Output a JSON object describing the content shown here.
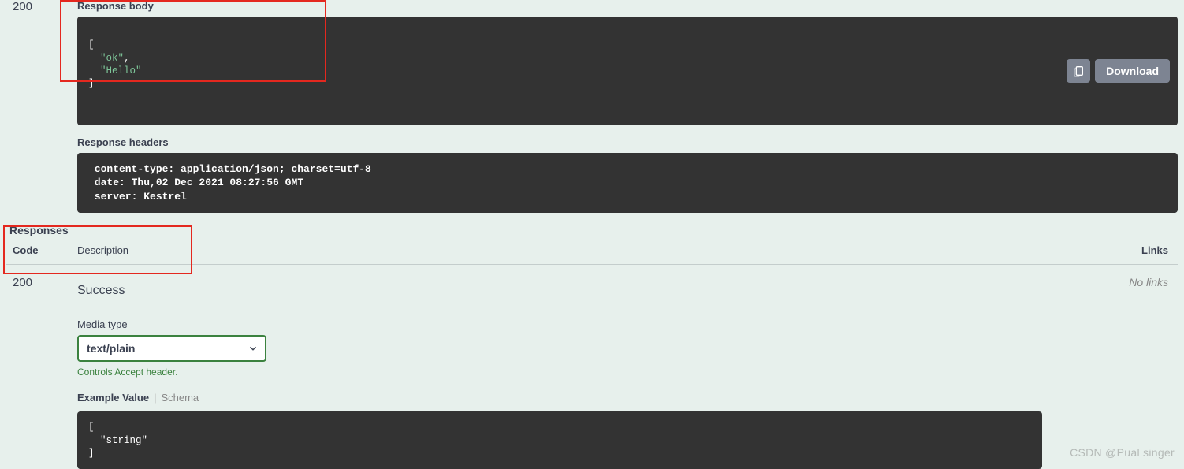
{
  "first": {
    "code": "200",
    "response_body_label": "Response body",
    "response_body_lines": [
      "[",
      "  \"ok\",",
      "  \"Hello\"",
      "]"
    ],
    "download_btn": "Download",
    "response_headers_label": "Response headers",
    "response_headers": " content-type: application/json; charset=utf-8 \n date: Thu,02 Dec 2021 08:27:56 GMT \n server: Kestrel "
  },
  "responses_title": "Responses",
  "head": {
    "code": "Code",
    "desc": "Description",
    "links": "Links"
  },
  "resp": {
    "code": "200",
    "desc": "Success",
    "links": "No links",
    "media_type_label": "Media type",
    "media_type_value": "text/plain",
    "accept_hint": "Controls Accept header.",
    "tabs": {
      "example": "Example Value",
      "schema": "Schema"
    },
    "example_lines": [
      "[",
      "  \"string\"",
      "]"
    ]
  },
  "watermark": "CSDN @Pual singer"
}
